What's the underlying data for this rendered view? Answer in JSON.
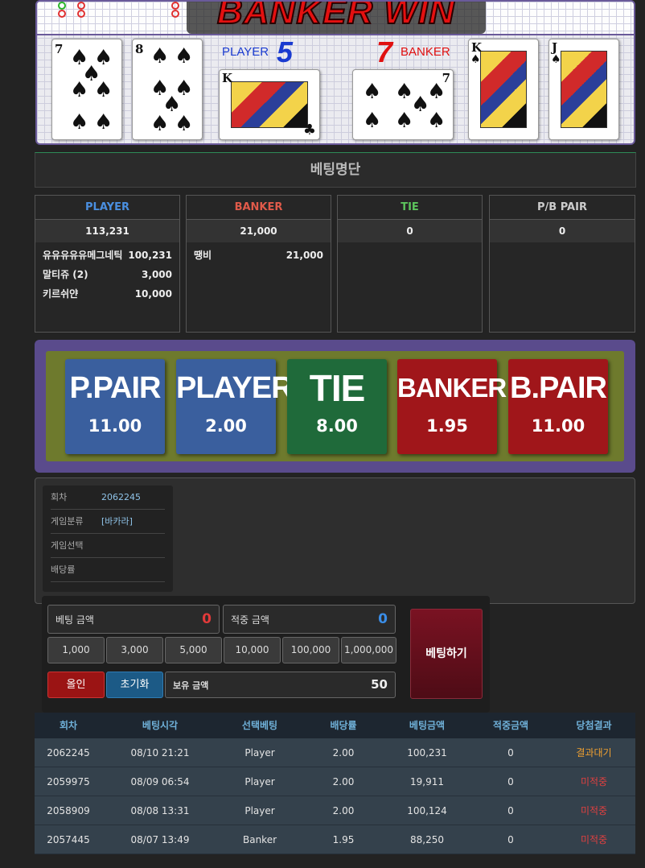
{
  "game_board": {
    "banner_text": "BANKER WIN",
    "player_label": "PLAYER",
    "player_score": "5",
    "banker_label": "BANKER",
    "banker_score": "7",
    "player_cards": [
      {
        "rank": "7",
        "suit": "♠"
      },
      {
        "rank": "8",
        "suit": "♠"
      },
      {
        "rank": "K",
        "suit": "♣"
      }
    ],
    "banker_cards": [
      {
        "rank": "7",
        "suit": "♠"
      },
      {
        "rank": "K",
        "suit": "♠"
      },
      {
        "rank": "J",
        "suit": "♠"
      }
    ]
  },
  "betting_list": {
    "title": "베팅명단",
    "columns": [
      {
        "header": "PLAYER",
        "total": "113,231",
        "color": "#4a8fe0",
        "entries": [
          {
            "name": "유유유유유메그네틱",
            "amount": "100,231"
          },
          {
            "name": "말티쥬 (2)",
            "amount": "3,000"
          },
          {
            "name": "키르쉬얀",
            "amount": "10,000"
          }
        ]
      },
      {
        "header": "BANKER",
        "total": "21,000",
        "color": "#e05a4a",
        "entries": [
          {
            "name": "땡비",
            "amount": "21,000"
          }
        ]
      },
      {
        "header": "TIE",
        "total": "0",
        "color": "#5cc45c",
        "entries": []
      },
      {
        "header": "P/B PAIR",
        "total": "0",
        "color": "#cccccc",
        "entries": []
      }
    ]
  },
  "odds": [
    {
      "name": "P.PAIR",
      "odds": "11.00",
      "color": "#3a5f9e"
    },
    {
      "name": "PLAYER",
      "odds": "2.00",
      "color": "#3a5f9e"
    },
    {
      "name": "TIE",
      "odds": "8.00",
      "color": "#1f6a3a"
    },
    {
      "name": "BANKER",
      "odds": "1.95",
      "color": "#a0161a"
    },
    {
      "name": "B.PAIR",
      "odds": "11.00",
      "color": "#a0161a"
    }
  ],
  "round_info": {
    "round_label": "회차",
    "round_value": "2062245",
    "game_type_label": "게임분류",
    "game_type_value": "[바카라]",
    "game_select_label": "게임선택",
    "game_select_value": "",
    "odds_label": "배당률",
    "odds_value": ""
  },
  "bet_controls": {
    "bet_amount_label": "베팅 금액",
    "bet_amount_value": "0",
    "win_amount_label": "적중 금액",
    "win_amount_value": "0",
    "chips": [
      "1,000",
      "3,000",
      "5,000",
      "10,000",
      "100,000",
      "1,000,000"
    ],
    "all_in_label": "올인",
    "reset_label": "초기화",
    "balance_label": "보유 금액",
    "balance_value": "50",
    "bet_button_label": "베팅하기"
  },
  "history": {
    "headers": [
      "회차",
      "베팅시각",
      "선택베팅",
      "배당률",
      "베팅금액",
      "적중금액",
      "당첨결과"
    ],
    "rows": [
      {
        "round": "2062245",
        "time": "08/10 21:21",
        "pick": "Player",
        "odds": "2.00",
        "bet": "100,231",
        "win": "0",
        "result": "결과대기",
        "result_color": "#f0a030"
      },
      {
        "round": "2059975",
        "time": "08/09 06:54",
        "pick": "Player",
        "odds": "2.00",
        "bet": "19,911",
        "win": "0",
        "result": "미적중",
        "result_color": "#e04040"
      },
      {
        "round": "2058909",
        "time": "08/08 13:31",
        "pick": "Player",
        "odds": "2.00",
        "bet": "100,124",
        "win": "0",
        "result": "미적중",
        "result_color": "#e04040"
      },
      {
        "round": "2057445",
        "time": "08/07 13:49",
        "pick": "Banker",
        "odds": "1.95",
        "bet": "88,250",
        "win": "0",
        "result": "미적중",
        "result_color": "#e04040"
      }
    ]
  }
}
